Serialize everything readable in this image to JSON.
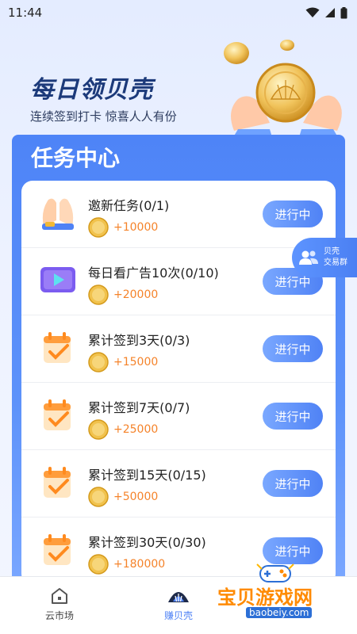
{
  "status_bar": {
    "time": "11:44"
  },
  "hero": {
    "title": "每日领贝壳",
    "subtitle": "连续签到打卡   惊喜人人有份"
  },
  "panel": {
    "title": "任务中心"
  },
  "tasks": [
    {
      "name": "邀新任务(0/1)",
      "reward": "+10000",
      "button": "进行中",
      "icon": "hands-icon"
    },
    {
      "name": "每日看广告10次(0/10)",
      "reward": "+20000",
      "button": "进行中",
      "icon": "video-play-icon"
    },
    {
      "name": "累计签到3天(0/3)",
      "reward": "+15000",
      "button": "进行中",
      "icon": "calendar-check-icon"
    },
    {
      "name": "累计签到7天(0/7)",
      "reward": "+25000",
      "button": "进行中",
      "icon": "calendar-check-icon"
    },
    {
      "name": "累计签到15天(0/15)",
      "reward": "+50000",
      "button": "进行中",
      "icon": "calendar-check-icon"
    },
    {
      "name": "累计签到30天(0/30)",
      "reward": "+180000",
      "button": "进行中",
      "icon": "calendar-check-icon"
    }
  ],
  "float_button": {
    "line1": "贝壳",
    "line2": "交易群"
  },
  "tab_bar": {
    "items": [
      {
        "label": "云市场",
        "icon": "home-icon",
        "active": false
      },
      {
        "label": "赚贝壳",
        "icon": "shell-icon",
        "active": true
      }
    ]
  },
  "watermark": {
    "text": "宝贝游戏网",
    "url": "baobeiy.com"
  },
  "colors": {
    "accent": "#4f82f5",
    "reward": "#f5832a",
    "panel": "#4e84f7"
  }
}
